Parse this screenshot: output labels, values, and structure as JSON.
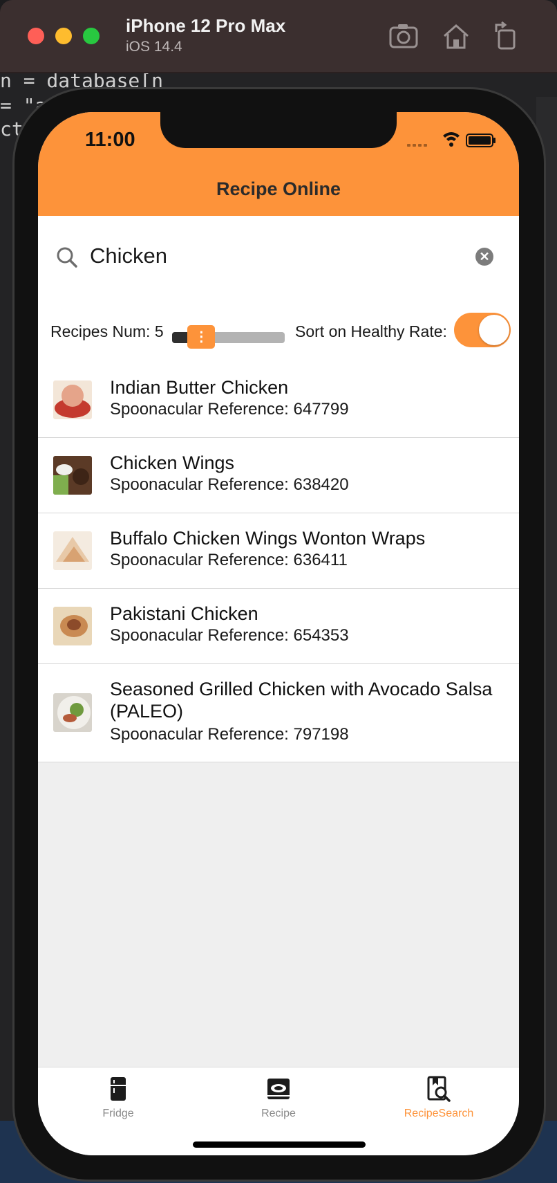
{
  "window": {
    "title": "iPhone 12 Pro Max",
    "subtitle": "iOS 14.4",
    "icons": [
      "screenshot-icon",
      "home-icon",
      "rotate-icon"
    ]
  },
  "status_bar": {
    "time": "11:00"
  },
  "header": {
    "title": "Recipe Online"
  },
  "search": {
    "value": "Chicken"
  },
  "controls": {
    "recipes_num_label": "Recipes Num: 5",
    "slider_value": 5,
    "sort_label": "Sort on Healthy Rate:",
    "sort_on": true
  },
  "recipes": [
    {
      "title": "Indian Butter Chicken",
      "ref": "Spoonacular Reference: 647799",
      "thumb_colors": [
        "#e5a48a",
        "#c43a2e",
        "#f3e6d8"
      ]
    },
    {
      "title": "Chicken Wings",
      "ref": "Spoonacular Reference: 638420",
      "thumb_colors": [
        "#5b3a26",
        "#7fae4e",
        "#f0f0ec"
      ]
    },
    {
      "title": "Buffalo Chicken Wings Wonton Wraps",
      "ref": "Spoonacular Reference: 636411",
      "thumb_colors": [
        "#e8c9a8",
        "#d8a272",
        "#f4ebe0"
      ]
    },
    {
      "title": "Pakistani Chicken",
      "ref": "Spoonacular Reference: 654353",
      "thumb_colors": [
        "#c98a52",
        "#8c4b2a",
        "#e9d7b8"
      ]
    },
    {
      "title": "Seasoned Grilled Chicken with Avocado Salsa (PALEO)",
      "ref": "Spoonacular Reference: 797198",
      "thumb_colors": [
        "#f1efea",
        "#6f9a3e",
        "#b55b3a"
      ]
    }
  ],
  "tabs": [
    {
      "label": "Fridge",
      "icon": "fridge-icon",
      "active": false
    },
    {
      "label": "Recipe",
      "icon": "recipe-icon",
      "active": false
    },
    {
      "label": "RecipeSearch",
      "icon": "recipe-search-icon",
      "active": true
    }
  ],
  "colors": {
    "accent": "#fd933a",
    "list_bg": "#ffffff",
    "screen_bg": "#efefef"
  },
  "background_code": [
    "n = database[n",
    "= \"a",
    "ct"
  ]
}
